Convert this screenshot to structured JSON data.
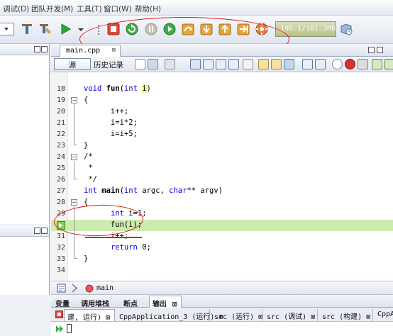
{
  "menu": {
    "items": [
      "调试(D)",
      "团队开发(M)",
      "工具(T)",
      "窗口(W)",
      "帮助(H)"
    ]
  },
  "toolbar": {
    "icons": [
      "build-icon",
      "clean-build-icon",
      "run-icon",
      "debug-icon",
      "finish-debug-icon",
      "restart-icon",
      "pause-icon",
      "continue-icon",
      "step-over-icon",
      "step-into-icon",
      "step-out-icon",
      "run-to-cursor-icon",
      "apply-code-changes-icon"
    ],
    "memory_label": "198.1/181.3MB"
  },
  "editor": {
    "file_tab": "main.cpp",
    "tab_close": "⊠",
    "source_button": "源",
    "history_button": "历史记录",
    "code_lines": [
      {
        "num": "18",
        "text": "void fun(int i)"
      },
      {
        "num": "19",
        "text": "{"
      },
      {
        "num": "20",
        "text": "      i++;"
      },
      {
        "num": "21",
        "text": "      i=i*2;"
      },
      {
        "num": "22",
        "text": "      i=i+5;"
      },
      {
        "num": "23",
        "text": "}"
      },
      {
        "num": "24",
        "text": "/*"
      },
      {
        "num": "25",
        "text": " *"
      },
      {
        "num": "26",
        "text": " */"
      },
      {
        "num": "27",
        "text": "int main(int argc, char** argv)"
      },
      {
        "num": "28",
        "text": "{"
      },
      {
        "num": "29",
        "text": "      int i=1;"
      },
      {
        "num": "30",
        "text": "      fun(i);"
      },
      {
        "num": "31",
        "text": "      i++;"
      },
      {
        "num": "32",
        "text": "      return 0;"
      },
      {
        "num": "33",
        "text": "}"
      },
      {
        "num": "34",
        "text": ""
      }
    ],
    "current_line": "30"
  },
  "breadcrumb": {
    "function": "main"
  },
  "bottom_panel": {
    "tabs": [
      "变量",
      "调用堆栈",
      "断点",
      "输出"
    ],
    "active_tab": "输出",
    "output_tabs": [
      "建, 运行) ⊠",
      "CppApplication_3 (运行) ⊠",
      "src (运行) ⊠",
      "src (调试) ⊠",
      "src (构建) ⊠",
      "CppAp"
    ]
  },
  "colors": {
    "current_line": "#ccebae",
    "annotation_red": "#e01818",
    "keyword": "#0000e6"
  }
}
